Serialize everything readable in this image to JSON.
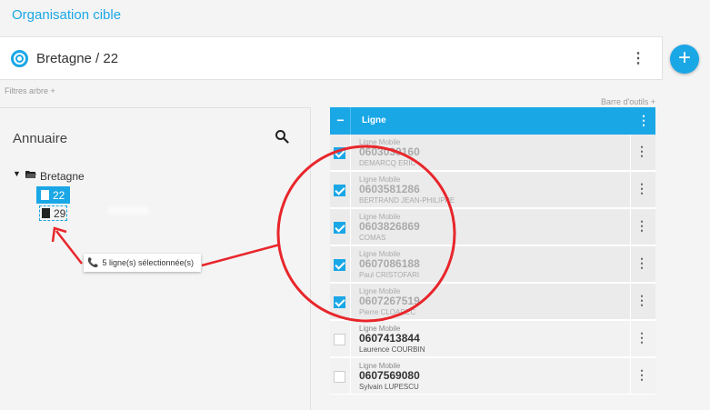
{
  "page": {
    "title": "Organisation cible"
  },
  "org": {
    "label": "Bretagne / 22",
    "more_icon": "more-vert-icon"
  },
  "actions": {
    "add_icon": "plus-icon",
    "add_symbol": "+"
  },
  "filters": {
    "tree_label": "Filtres arbre +",
    "toolbar_label": "Barre d'outils +"
  },
  "annuaire": {
    "title": "Annuaire",
    "search_icon": "search-icon",
    "tree": {
      "root": {
        "label": "Bretagne",
        "expanded": true
      },
      "children": [
        {
          "label": "22",
          "selected": true
        },
        {
          "label": "29",
          "focused": true
        }
      ]
    }
  },
  "tooltip": {
    "text": "5 ligne(s) sélectionnée(s)",
    "icon": "phone-icon"
  },
  "grid": {
    "header": {
      "check_symbol": "−",
      "label": "Ligne",
      "more_symbol": "⋮"
    },
    "rows": [
      {
        "type": "Ligne Mobile",
        "number": "0603030160",
        "name": "DEMARCQ ERIC",
        "checked": true
      },
      {
        "type": "Ligne Mobile",
        "number": "0603581286",
        "name": "BERTRAND JEAN-PHILIPPE",
        "checked": true
      },
      {
        "type": "Ligne Mobile",
        "number": "0603826869",
        "name": "COMAS",
        "checked": true
      },
      {
        "type": "Ligne Mobile",
        "number": "0607086188",
        "name": "Paul CRISTOFARI",
        "checked": true
      },
      {
        "type": "Ligne Mobile",
        "number": "0607267519",
        "name": "Pierre CLOAREC",
        "checked": true
      },
      {
        "type": "Ligne Mobile",
        "number": "0607413844",
        "name": "Laurence COURBIN",
        "checked": false
      },
      {
        "type": "Ligne Mobile",
        "number": "0607569080",
        "name": "Sylvain LUPESCU",
        "checked": false
      }
    ]
  },
  "colors": {
    "accent": "#1aa7e6",
    "annotation": "#e8262b"
  }
}
